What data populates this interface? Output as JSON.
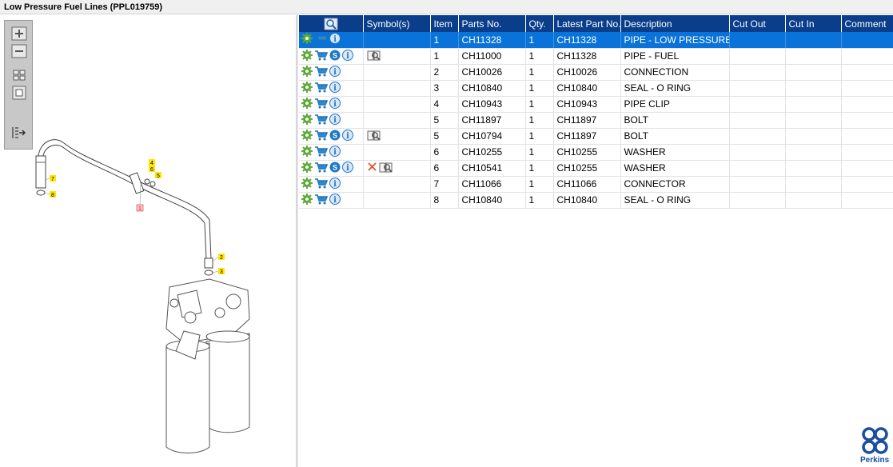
{
  "window": {
    "title": "Low Pressure Fuel Lines (PPL019759)"
  },
  "toolbox": {
    "tools": [
      "zoom-in",
      "zoom-out",
      "fit-all",
      "fit-window",
      "export"
    ]
  },
  "diagram": {
    "callouts": [
      "7",
      "8",
      "4",
      "6",
      "5",
      "1",
      "2",
      "3"
    ]
  },
  "table": {
    "columns": [
      "",
      "Symbol(s)",
      "Item",
      "Parts No.",
      "Qty.",
      "Latest Part No.",
      "Description",
      "Cut Out",
      "Cut In",
      "Comment"
    ],
    "rows": [
      {
        "item": "1",
        "part": "CH11328",
        "qty": "1",
        "latest": "CH11328",
        "desc": "PIPE - LOW PRESSURE FUEL",
        "s_icon": false,
        "symbols": [],
        "selected": true
      },
      {
        "item": "1",
        "part": "CH11000",
        "qty": "1",
        "latest": "CH11328",
        "desc": "PIPE - FUEL",
        "s_icon": true,
        "symbols": [
          "book-search"
        ],
        "selected": false
      },
      {
        "item": "2",
        "part": "CH10026",
        "qty": "1",
        "latest": "CH10026",
        "desc": "CONNECTION",
        "s_icon": false,
        "symbols": [],
        "selected": false
      },
      {
        "item": "3",
        "part": "CH10840",
        "qty": "1",
        "latest": "CH10840",
        "desc": "SEAL - O RING",
        "s_icon": false,
        "symbols": [],
        "selected": false
      },
      {
        "item": "4",
        "part": "CH10943",
        "qty": "1",
        "latest": "CH10943",
        "desc": "PIPE CLIP",
        "s_icon": false,
        "symbols": [],
        "selected": false
      },
      {
        "item": "5",
        "part": "CH11897",
        "qty": "1",
        "latest": "CH11897",
        "desc": "BOLT",
        "s_icon": false,
        "symbols": [],
        "selected": false
      },
      {
        "item": "5",
        "part": "CH10794",
        "qty": "1",
        "latest": "CH11897",
        "desc": "BOLT",
        "s_icon": true,
        "symbols": [
          "book-search"
        ],
        "selected": false
      },
      {
        "item": "6",
        "part": "CH10255",
        "qty": "1",
        "latest": "CH10255",
        "desc": "WASHER",
        "s_icon": false,
        "symbols": [],
        "selected": false
      },
      {
        "item": "6",
        "part": "CH10541",
        "qty": "1",
        "latest": "CH10255",
        "desc": "WASHER",
        "s_icon": true,
        "symbols": [
          "cross",
          "book-search"
        ],
        "selected": false
      },
      {
        "item": "7",
        "part": "CH11066",
        "qty": "1",
        "latest": "CH11066",
        "desc": "CONNECTOR",
        "s_icon": false,
        "symbols": [],
        "selected": false
      },
      {
        "item": "8",
        "part": "CH10840",
        "qty": "1",
        "latest": "CH10840",
        "desc": "SEAL - O RING",
        "s_icon": false,
        "symbols": [],
        "selected": false
      }
    ]
  },
  "logo": {
    "text": "Perkins",
    "color": "#1a4fa0"
  },
  "colors": {
    "header": "#0a3d8a",
    "selected": "#0a73d9",
    "gear": "#5aa832",
    "cart": "#1d6fb8",
    "info": "#1e78c8"
  }
}
